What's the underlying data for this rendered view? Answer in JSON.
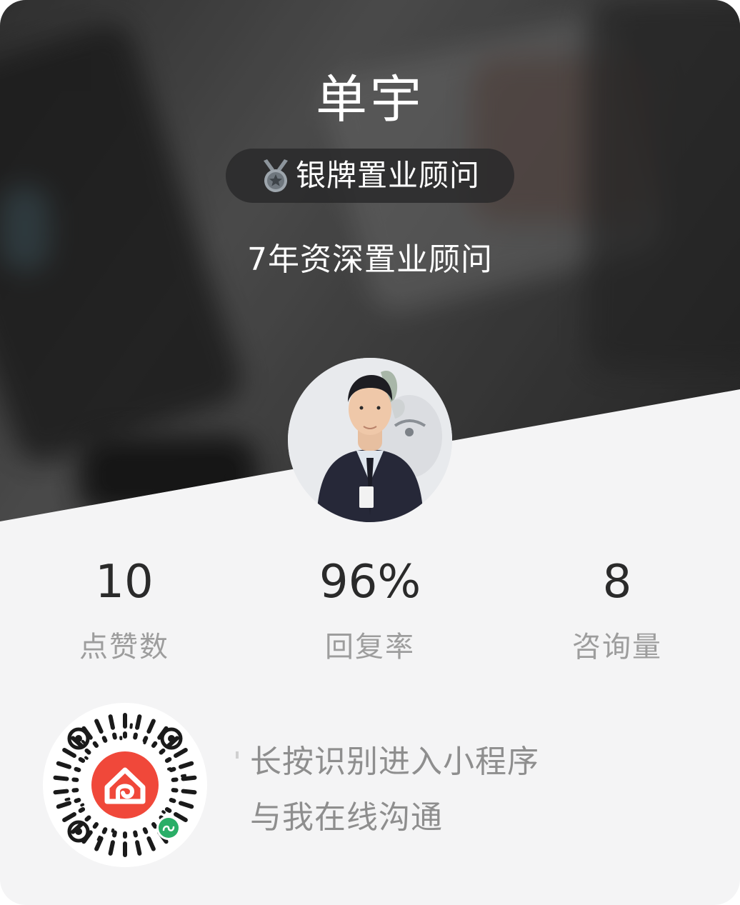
{
  "agent": {
    "name": "单宇",
    "badge_label": "银牌置业顾问",
    "subtitle": "7年资深置业顾问"
  },
  "stats": [
    {
      "value": "10",
      "label": "点赞数"
    },
    {
      "value": "96%",
      "label": "回复率"
    },
    {
      "value": "8",
      "label": "咨询量"
    }
  ],
  "cta": {
    "line1": "长按识别进入小程序",
    "line2": "与我在线沟通"
  },
  "colors": {
    "card_background": "#f4f4f5",
    "badge_background": "#28282a",
    "stat_value": "#2a2a2a",
    "stat_label": "#9d9d9d",
    "cta_text": "#8e8e8e",
    "mini_program_logo": "#f0483a",
    "mini_program_badge": "#2aae67"
  },
  "icons": {
    "badge": "silver-medal-icon",
    "qr_center": "home-logo-icon",
    "qr_corner": "mini-program-icon"
  }
}
